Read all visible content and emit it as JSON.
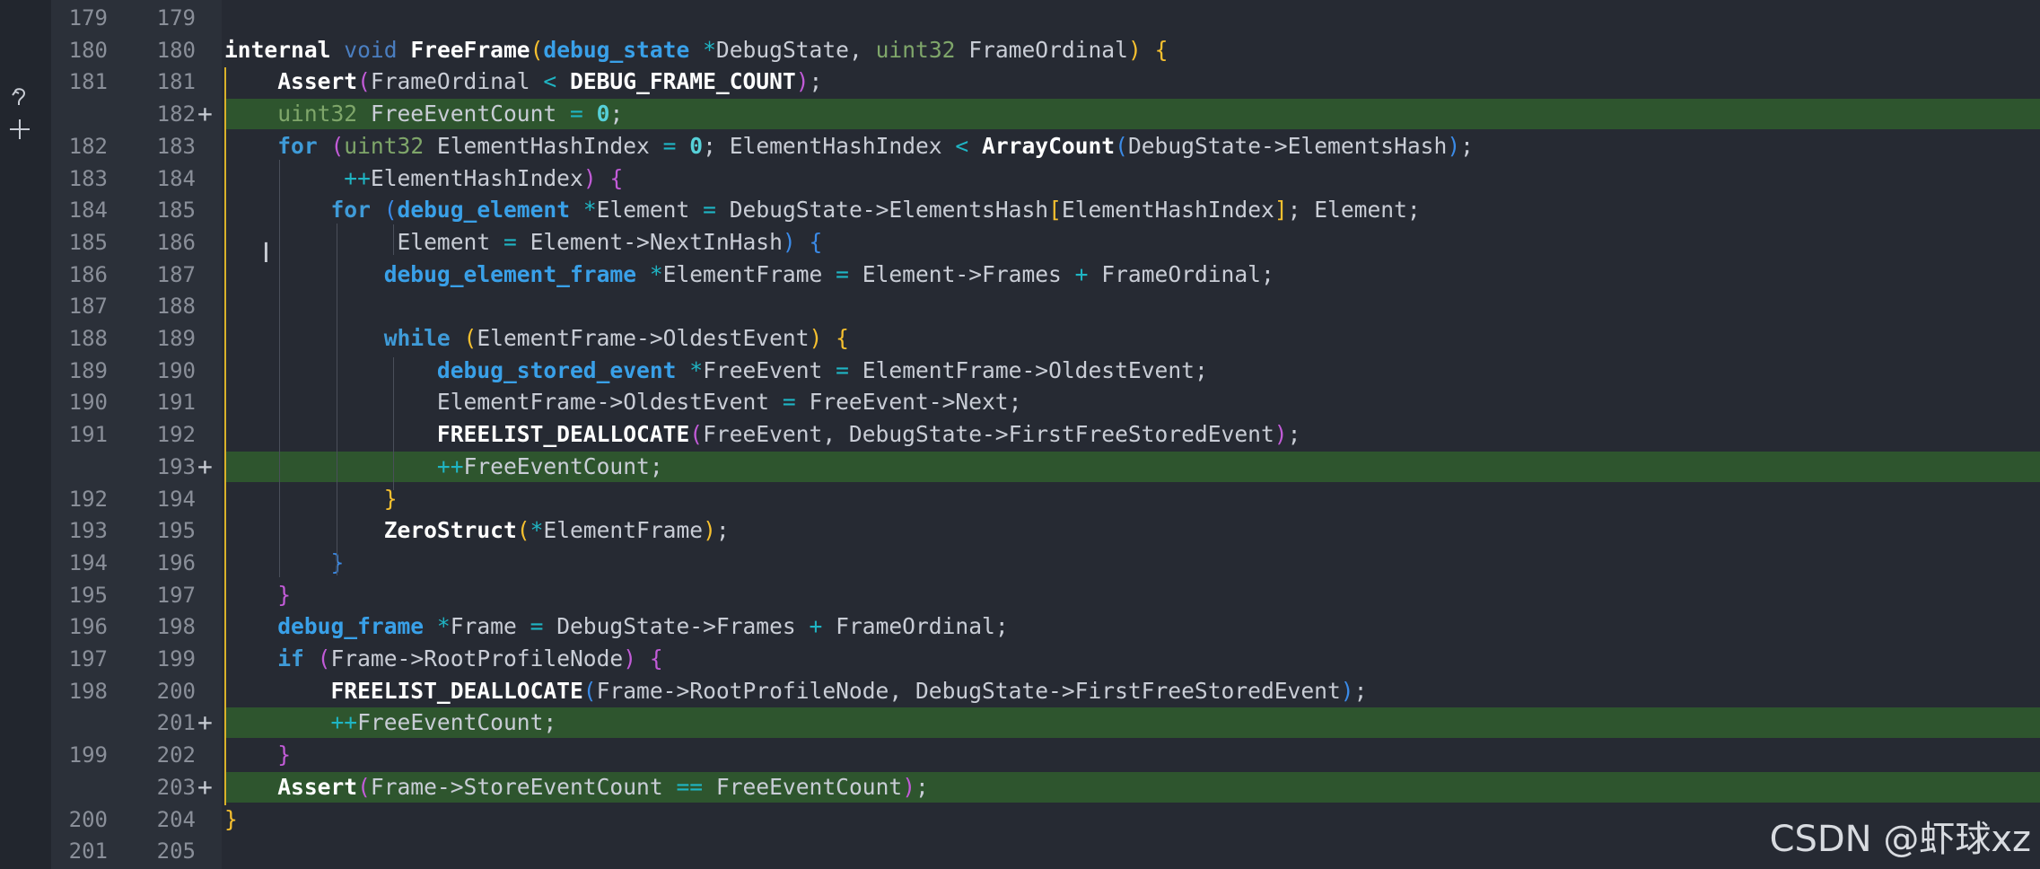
{
  "gutter": {
    "actions": [
      {
        "icon": "revert-icon"
      },
      {
        "icon": "plus-icon"
      }
    ]
  },
  "lines": [
    {
      "old": "179",
      "new": "179",
      "added": false,
      "mark": "",
      "tokens": []
    },
    {
      "old": "180",
      "new": "180",
      "added": false,
      "mark": "",
      "tokens": [
        {
          "t": "internal",
          "c": "hdr"
        },
        {
          "t": " ",
          "c": "id"
        },
        {
          "t": "void",
          "c": "kw2"
        },
        {
          "t": " ",
          "c": "id"
        },
        {
          "t": "FreeFrame",
          "c": "fn"
        },
        {
          "t": "(",
          "c": "br-y"
        },
        {
          "t": "debug_state",
          "c": "tyb"
        },
        {
          "t": " ",
          "c": "id"
        },
        {
          "t": "*",
          "c": "op"
        },
        {
          "t": "DebugState, ",
          "c": "id"
        },
        {
          "t": "uint32",
          "c": "ty"
        },
        {
          "t": " FrameOrdinal",
          "c": "id"
        },
        {
          "t": ")",
          "c": "br-y"
        },
        {
          "t": " ",
          "c": "id"
        },
        {
          "t": "{",
          "c": "br-y"
        }
      ]
    },
    {
      "old": "181",
      "new": "181",
      "added": false,
      "mark": "",
      "tokens": [
        {
          "t": "    ",
          "c": "id"
        },
        {
          "t": "Assert",
          "c": "fn"
        },
        {
          "t": "(",
          "c": "br-p"
        },
        {
          "t": "FrameOrdinal ",
          "c": "id"
        },
        {
          "t": "<",
          "c": "op"
        },
        {
          "t": " ",
          "c": "id"
        },
        {
          "t": "DEBUG_FRAME_COUNT",
          "c": "fn"
        },
        {
          "t": ")",
          "c": "br-p"
        },
        {
          "t": ";",
          "c": "id"
        }
      ]
    },
    {
      "old": "",
      "new": "182",
      "added": true,
      "mark": "+",
      "tokens": [
        {
          "t": "    ",
          "c": "id"
        },
        {
          "t": "uint32",
          "c": "ty"
        },
        {
          "t": " FreeEventCount ",
          "c": "id"
        },
        {
          "t": "=",
          "c": "op"
        },
        {
          "t": " ",
          "c": "id"
        },
        {
          "t": "0",
          "c": "num"
        },
        {
          "t": ";",
          "c": "id"
        }
      ]
    },
    {
      "old": "182",
      "new": "183",
      "added": false,
      "mark": "",
      "tokens": [
        {
          "t": "    ",
          "c": "id"
        },
        {
          "t": "for",
          "c": "kw"
        },
        {
          "t": " ",
          "c": "id"
        },
        {
          "t": "(",
          "c": "br-p"
        },
        {
          "t": "uint32",
          "c": "ty"
        },
        {
          "t": " ElementHashIndex ",
          "c": "id"
        },
        {
          "t": "=",
          "c": "op"
        },
        {
          "t": " ",
          "c": "id"
        },
        {
          "t": "0",
          "c": "num"
        },
        {
          "t": "; ElementHashIndex ",
          "c": "id"
        },
        {
          "t": "<",
          "c": "op"
        },
        {
          "t": " ",
          "c": "id"
        },
        {
          "t": "ArrayCount",
          "c": "fn"
        },
        {
          "t": "(",
          "c": "br-b"
        },
        {
          "t": "DebugState->ElementsHash",
          "c": "id"
        },
        {
          "t": ")",
          "c": "br-b"
        },
        {
          "t": ";",
          "c": "id"
        }
      ]
    },
    {
      "old": "183",
      "new": "184",
      "added": false,
      "mark": "",
      "tokens": [
        {
          "t": "         ",
          "c": "id"
        },
        {
          "t": "++",
          "c": "op"
        },
        {
          "t": "ElementHashIndex",
          "c": "id"
        },
        {
          "t": ")",
          "c": "br-p"
        },
        {
          "t": " ",
          "c": "id"
        },
        {
          "t": "{",
          "c": "br-p"
        }
      ]
    },
    {
      "old": "184",
      "new": "185",
      "added": false,
      "mark": "",
      "tokens": [
        {
          "t": "        ",
          "c": "id"
        },
        {
          "t": "for",
          "c": "kw"
        },
        {
          "t": " ",
          "c": "id"
        },
        {
          "t": "(",
          "c": "br-b"
        },
        {
          "t": "debug_element",
          "c": "tyb"
        },
        {
          "t": " ",
          "c": "id"
        },
        {
          "t": "*",
          "c": "op"
        },
        {
          "t": "Element ",
          "c": "id"
        },
        {
          "t": "=",
          "c": "op"
        },
        {
          "t": " DebugState->ElementsHash",
          "c": "id"
        },
        {
          "t": "[",
          "c": "br-y"
        },
        {
          "t": "ElementHashIndex",
          "c": "id"
        },
        {
          "t": "]",
          "c": "br-y"
        },
        {
          "t": "; Element;",
          "c": "id"
        }
      ]
    },
    {
      "old": "185",
      "new": "186",
      "added": false,
      "mark": "",
      "tokens": [
        {
          "t": "             Element ",
          "c": "id"
        },
        {
          "t": "=",
          "c": "op"
        },
        {
          "t": " Element->NextInHash",
          "c": "id"
        },
        {
          "t": ")",
          "c": "br-b"
        },
        {
          "t": " ",
          "c": "id"
        },
        {
          "t": "{",
          "c": "br-b"
        }
      ]
    },
    {
      "old": "186",
      "new": "187",
      "added": false,
      "mark": "",
      "tokens": [
        {
          "t": "            ",
          "c": "id"
        },
        {
          "t": "debug_element_frame",
          "c": "tyb"
        },
        {
          "t": " ",
          "c": "id"
        },
        {
          "t": "*",
          "c": "op"
        },
        {
          "t": "ElementFrame ",
          "c": "id"
        },
        {
          "t": "=",
          "c": "op"
        },
        {
          "t": " Element->Frames ",
          "c": "id"
        },
        {
          "t": "+",
          "c": "op"
        },
        {
          "t": " FrameOrdinal;",
          "c": "id"
        }
      ]
    },
    {
      "old": "187",
      "new": "188",
      "added": false,
      "mark": "",
      "tokens": []
    },
    {
      "old": "188",
      "new": "189",
      "added": false,
      "mark": "",
      "tokens": [
        {
          "t": "            ",
          "c": "id"
        },
        {
          "t": "while",
          "c": "kw"
        },
        {
          "t": " ",
          "c": "id"
        },
        {
          "t": "(",
          "c": "br-y"
        },
        {
          "t": "ElementFrame->OldestEvent",
          "c": "id"
        },
        {
          "t": ")",
          "c": "br-y"
        },
        {
          "t": " ",
          "c": "id"
        },
        {
          "t": "{",
          "c": "br-y"
        }
      ]
    },
    {
      "old": "189",
      "new": "190",
      "added": false,
      "mark": "",
      "tokens": [
        {
          "t": "                ",
          "c": "id"
        },
        {
          "t": "debug_stored_event",
          "c": "tyb"
        },
        {
          "t": " ",
          "c": "id"
        },
        {
          "t": "*",
          "c": "op"
        },
        {
          "t": "FreeEvent ",
          "c": "id"
        },
        {
          "t": "=",
          "c": "op"
        },
        {
          "t": " ElementFrame->OldestEvent;",
          "c": "id"
        }
      ]
    },
    {
      "old": "190",
      "new": "191",
      "added": false,
      "mark": "",
      "tokens": [
        {
          "t": "                ElementFrame->OldestEvent ",
          "c": "id"
        },
        {
          "t": "=",
          "c": "op"
        },
        {
          "t": " FreeEvent->Next;",
          "c": "id"
        }
      ]
    },
    {
      "old": "191",
      "new": "192",
      "added": false,
      "mark": "",
      "tokens": [
        {
          "t": "                ",
          "c": "id"
        },
        {
          "t": "FREELIST_DEALLOCATE",
          "c": "fn"
        },
        {
          "t": "(",
          "c": "br-p"
        },
        {
          "t": "FreeEvent, DebugState->FirstFreeStoredEvent",
          "c": "id"
        },
        {
          "t": ")",
          "c": "br-p"
        },
        {
          "t": ";",
          "c": "id"
        }
      ]
    },
    {
      "old": "",
      "new": "193",
      "added": true,
      "mark": "+",
      "tokens": [
        {
          "t": "                ",
          "c": "id"
        },
        {
          "t": "++",
          "c": "op"
        },
        {
          "t": "FreeEventCount;",
          "c": "id"
        }
      ]
    },
    {
      "old": "192",
      "new": "194",
      "added": false,
      "mark": "",
      "tokens": [
        {
          "t": "            ",
          "c": "id"
        },
        {
          "t": "}",
          "c": "br-y"
        }
      ]
    },
    {
      "old": "193",
      "new": "195",
      "added": false,
      "mark": "",
      "tokens": [
        {
          "t": "            ",
          "c": "id"
        },
        {
          "t": "ZeroStruct",
          "c": "fn"
        },
        {
          "t": "(",
          "c": "br-y"
        },
        {
          "t": "*",
          "c": "op"
        },
        {
          "t": "ElementFrame",
          "c": "id"
        },
        {
          "t": ")",
          "c": "br-y"
        },
        {
          "t": ";",
          "c": "id"
        }
      ]
    },
    {
      "old": "194",
      "new": "196",
      "added": false,
      "mark": "",
      "tokens": [
        {
          "t": "        ",
          "c": "id"
        },
        {
          "t": "}",
          "c": "br-b"
        }
      ]
    },
    {
      "old": "195",
      "new": "197",
      "added": false,
      "mark": "",
      "tokens": [
        {
          "t": "    ",
          "c": "id"
        },
        {
          "t": "}",
          "c": "br-p"
        }
      ]
    },
    {
      "old": "196",
      "new": "198",
      "added": false,
      "mark": "",
      "tokens": [
        {
          "t": "    ",
          "c": "id"
        },
        {
          "t": "debug_frame",
          "c": "tyb"
        },
        {
          "t": " ",
          "c": "id"
        },
        {
          "t": "*",
          "c": "op"
        },
        {
          "t": "Frame ",
          "c": "id"
        },
        {
          "t": "=",
          "c": "op"
        },
        {
          "t": " DebugState->Frames ",
          "c": "id"
        },
        {
          "t": "+",
          "c": "op"
        },
        {
          "t": " FrameOrdinal;",
          "c": "id"
        }
      ]
    },
    {
      "old": "197",
      "new": "199",
      "added": false,
      "mark": "",
      "tokens": [
        {
          "t": "    ",
          "c": "id"
        },
        {
          "t": "if",
          "c": "kw"
        },
        {
          "t": " ",
          "c": "id"
        },
        {
          "t": "(",
          "c": "br-p"
        },
        {
          "t": "Frame->RootProfileNode",
          "c": "id"
        },
        {
          "t": ")",
          "c": "br-p"
        },
        {
          "t": " ",
          "c": "id"
        },
        {
          "t": "{",
          "c": "br-p"
        }
      ]
    },
    {
      "old": "198",
      "new": "200",
      "added": false,
      "mark": "",
      "tokens": [
        {
          "t": "        ",
          "c": "id"
        },
        {
          "t": "FREELIST_DEALLOCATE",
          "c": "fn"
        },
        {
          "t": "(",
          "c": "br-b"
        },
        {
          "t": "Frame->RootProfileNode, DebugState->FirstFreeStoredEvent",
          "c": "id"
        },
        {
          "t": ")",
          "c": "br-b"
        },
        {
          "t": ";",
          "c": "id"
        }
      ]
    },
    {
      "old": "",
      "new": "201",
      "added": true,
      "mark": "+",
      "tokens": [
        {
          "t": "        ",
          "c": "id"
        },
        {
          "t": "++",
          "c": "op"
        },
        {
          "t": "FreeEventCount;",
          "c": "id"
        }
      ]
    },
    {
      "old": "199",
      "new": "202",
      "added": false,
      "mark": "",
      "tokens": [
        {
          "t": "    ",
          "c": "id"
        },
        {
          "t": "}",
          "c": "br-p"
        }
      ]
    },
    {
      "old": "",
      "new": "203",
      "added": true,
      "mark": "+",
      "tokens": [
        {
          "t": "    ",
          "c": "id"
        },
        {
          "t": "Assert",
          "c": "fn"
        },
        {
          "t": "(",
          "c": "br-p"
        },
        {
          "t": "Frame->StoreEventCount ",
          "c": "id"
        },
        {
          "t": "==",
          "c": "op"
        },
        {
          "t": " FreeEventCount",
          "c": "id"
        },
        {
          "t": ")",
          "c": "br-p"
        },
        {
          "t": ";",
          "c": "id"
        }
      ]
    },
    {
      "old": "200",
      "new": "204",
      "added": false,
      "mark": "",
      "tokens": [
        {
          "t": "}",
          "c": "br-y"
        }
      ]
    },
    {
      "old": "201",
      "new": "205",
      "added": false,
      "mark": "",
      "tokens": []
    }
  ],
  "watermark": "CSDN @虾球xz",
  "colors": {
    "background": "#262a33",
    "added_line": "#2e552e",
    "keyword": "#3f9bd8",
    "type": "#7fa66a",
    "bracket_yellow": "#f6c02f",
    "bracket_purple": "#c25bd8",
    "bracket_blue": "#3b8be8"
  }
}
